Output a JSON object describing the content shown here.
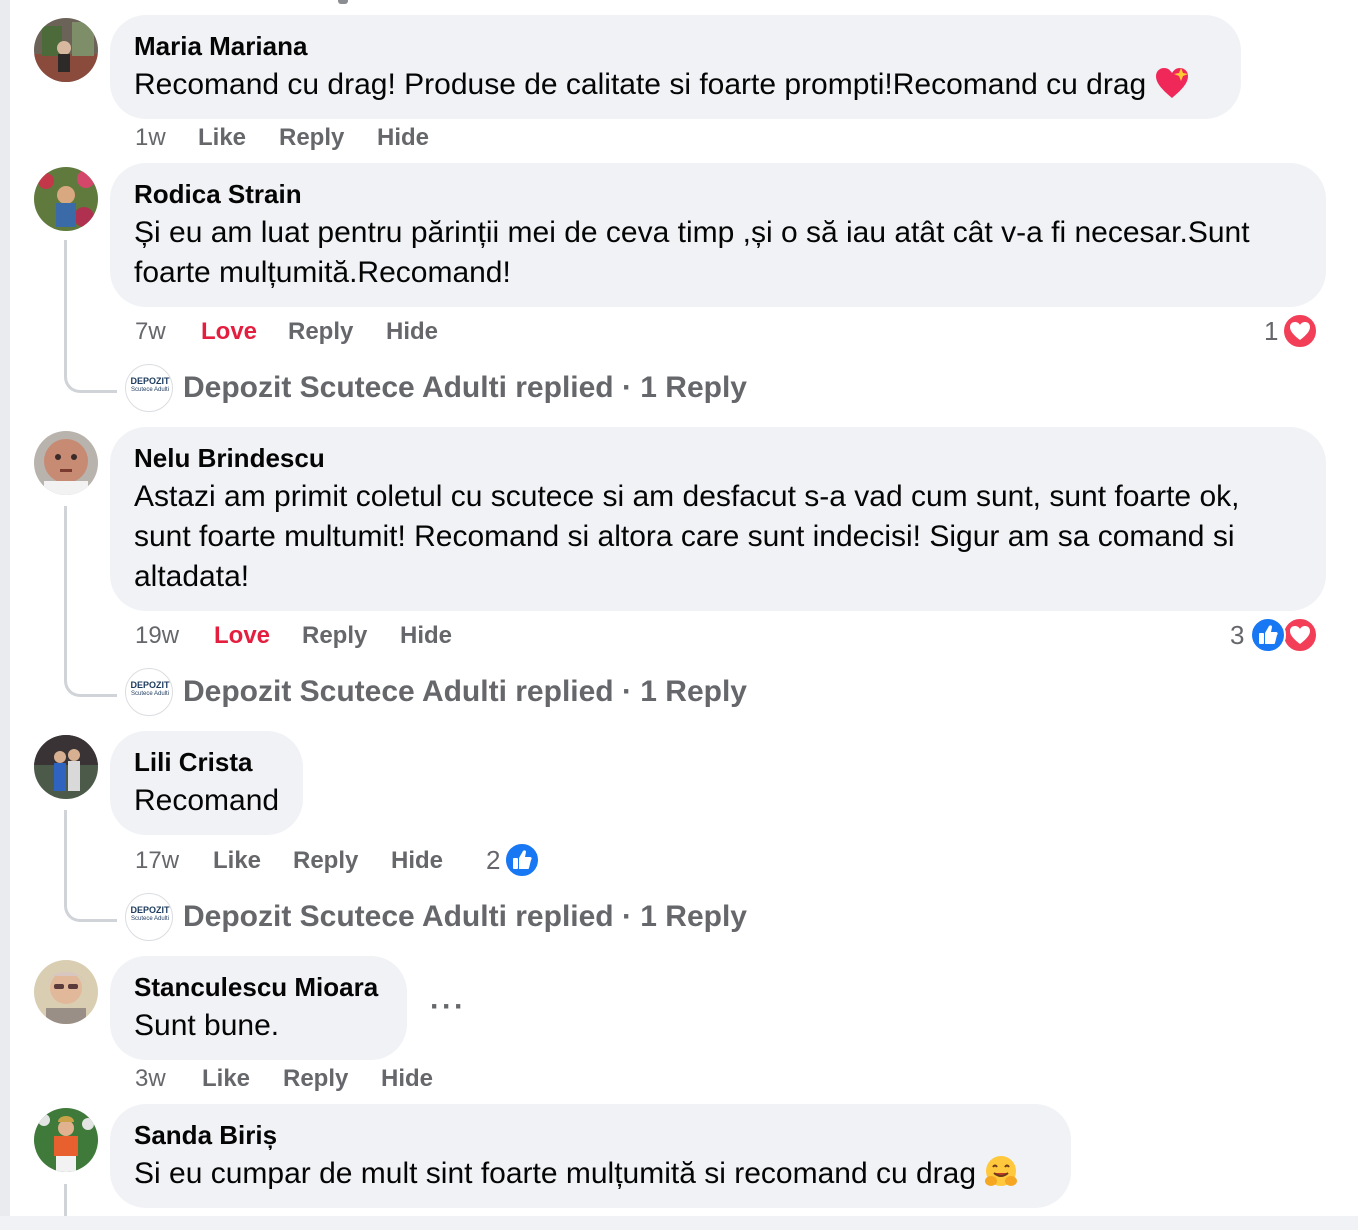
{
  "comments": [
    {
      "author": "Maria Mariana",
      "text": "Recomand cu drag! Produse de calitate si foarte prompti!Recomand cu drag",
      "emoji": "heart-sparkle-icon",
      "time": "1w",
      "like": "Like",
      "reply": "Reply",
      "hide": "Hide"
    },
    {
      "author": "Rodica Strain",
      "text_lines": [
        "Și eu am luat pentru părinții mei de ceva timp ,și o să iau atât cât v-a fi necesar.Sunt",
        "foarte mulțumită.Recomand!"
      ],
      "time": "7w",
      "like": "Love",
      "reply": "Reply",
      "hide": "Hide",
      "reaction_count": "1",
      "reactions": [
        "love-icon"
      ],
      "reply_summary": "Depozit Scutece Adulti replied · 1 Reply"
    },
    {
      "author": "Nelu Brindescu",
      "text_lines": [
        "Astazi am primit coletul cu scutece si am desfacut s-a vad cum sunt, sunt foarte ok,",
        "sunt foarte multumit! Recomand si altora care sunt indecisi! Sigur am sa comand si",
        "altadata!"
      ],
      "time": "19w",
      "like": "Love",
      "reply": "Reply",
      "hide": "Hide",
      "reaction_count": "3",
      "reactions": [
        "like-icon",
        "love-icon"
      ],
      "reply_summary": "Depozit Scutece Adulti replied · 1 Reply"
    },
    {
      "author": "Lili Crista",
      "text": "Recomand",
      "time": "17w",
      "like": "Like",
      "reply": "Reply",
      "hide": "Hide",
      "reaction_count": "2",
      "reactions": [
        "like-icon"
      ],
      "reply_summary": "Depozit Scutece Adulti replied · 1 Reply"
    },
    {
      "author": "Stanculescu Mioara",
      "text": "Sunt bune.",
      "more": "···",
      "time": "3w",
      "like": "Like",
      "reply": "Reply",
      "hide": "Hide"
    },
    {
      "author": "Sanda Biriș",
      "text": "Si eu cumpar de mult sint foarte mulțumită si recomand cu drag",
      "emoji": "hugging-face-icon"
    }
  ],
  "page": {
    "avatar_title": "DEPOZIT",
    "avatar_subtitle": "Scutece Adulti"
  },
  "colors": {
    "bubble": "#f0f2f5",
    "secondary_text": "#65676b",
    "love": "#e41e3f",
    "like": "#1877f2"
  }
}
